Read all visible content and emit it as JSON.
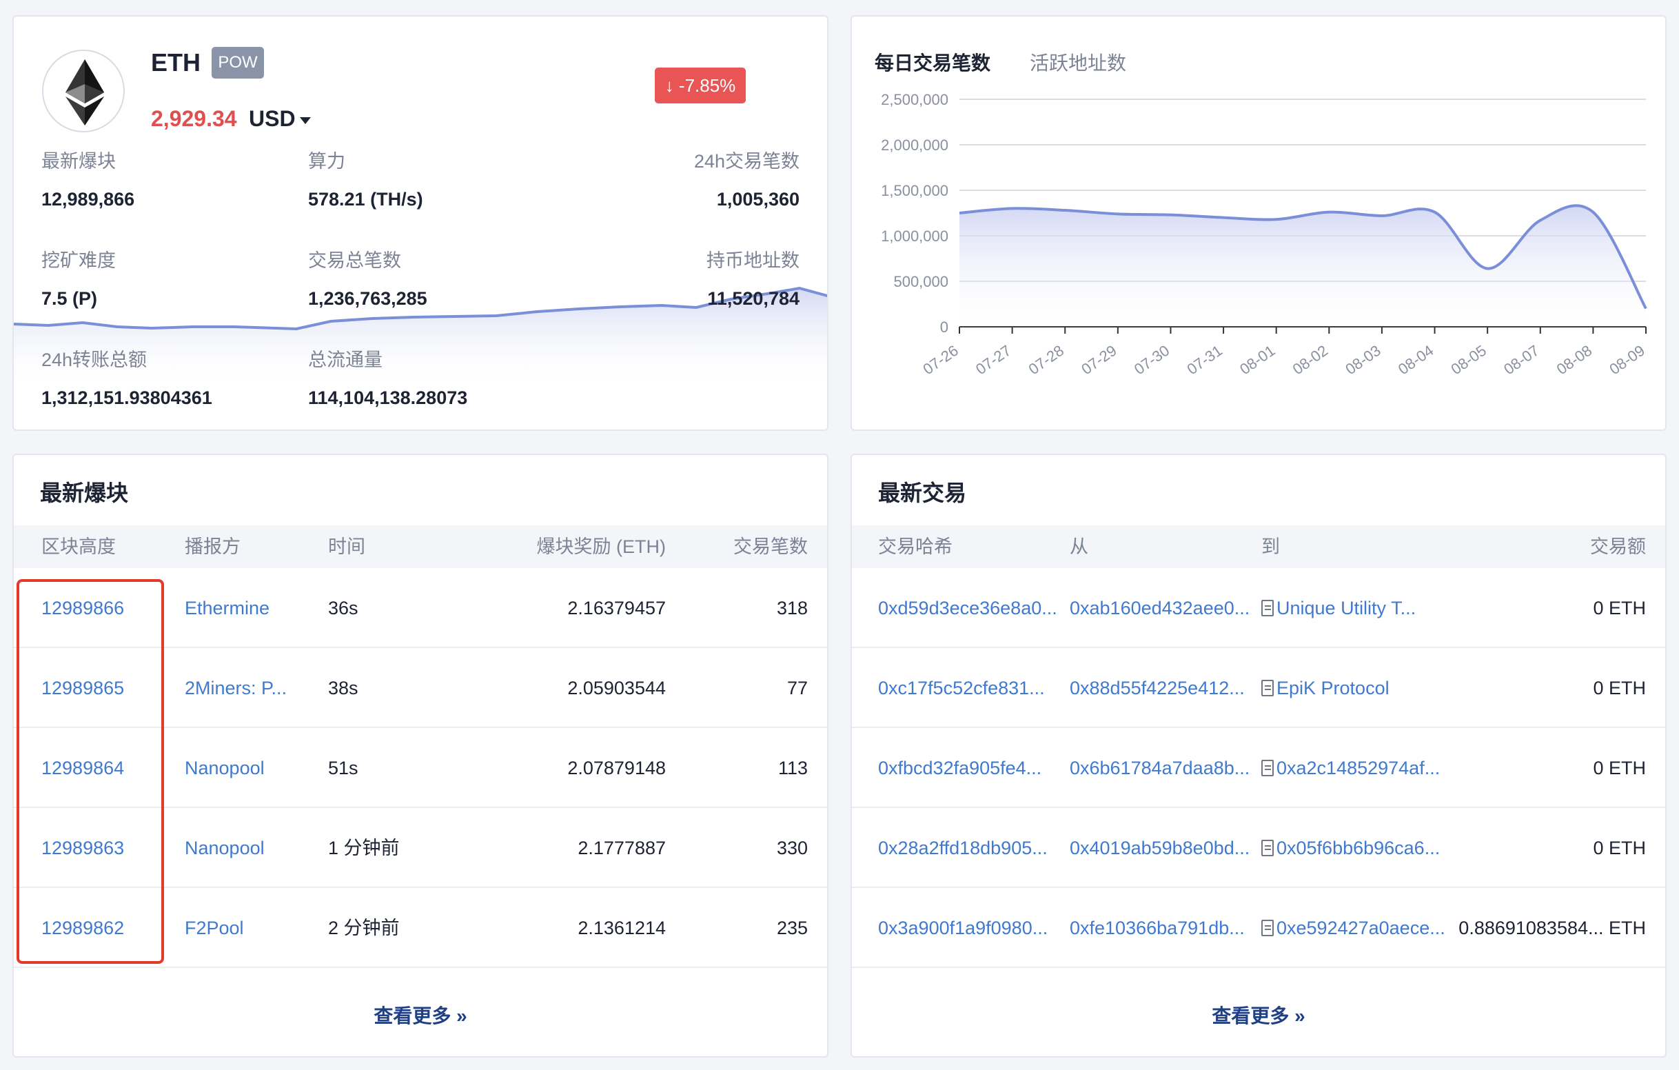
{
  "coin": {
    "name": "ETH",
    "badge": "POW",
    "price": "2,929.34",
    "currency": "USD",
    "change": "-7.85%",
    "change_color": "#e95454",
    "stats": [
      {
        "label": "最新爆块",
        "value": "12,989,866"
      },
      {
        "label": "算力",
        "value": "578.21 (TH/s)"
      },
      {
        "label": "24h交易笔数",
        "value": "1,005,360"
      },
      {
        "label": "挖矿难度",
        "value": "7.5 (P)"
      },
      {
        "label": "交易总笔数",
        "value": "1,236,763,285"
      },
      {
        "label": "持币地址数",
        "value": "11,520,784"
      },
      {
        "label": "24h转账总额",
        "value": "1,312,151.93804361"
      },
      {
        "label": "总流通量",
        "value": "114,104,138.28073"
      }
    ]
  },
  "chart_tabs": {
    "active": "每日交易笔数",
    "inactive": "活跃地址数"
  },
  "chart_data": {
    "type": "area",
    "categories": [
      "07-26",
      "07-27",
      "07-28",
      "07-29",
      "07-30",
      "07-31",
      "08-01",
      "08-02",
      "08-03",
      "08-04",
      "08-05",
      "08-07",
      "08-08",
      "08-09"
    ],
    "values": [
      1250000,
      1300000,
      1280000,
      1240000,
      1230000,
      1200000,
      1180000,
      1260000,
      1220000,
      1260000,
      640000,
      1170000,
      1260000,
      200000
    ],
    "yticks": [
      "0",
      "500,000",
      "1,000,000",
      "1,500,000",
      "2,000,000",
      "2,500,000"
    ],
    "ylim": [
      0,
      2500000
    ],
    "line_color": "#7b8fd8",
    "grid": true
  },
  "blocks": {
    "title": "最新爆块",
    "headers": {
      "height": "区块高度",
      "miner": "播报方",
      "time": "时间",
      "reward": "爆块奖励 (ETH)",
      "txs": "交易笔数"
    },
    "rows": [
      {
        "height": "12989866",
        "miner": "Ethermine",
        "time": "36s",
        "reward": "2.16379457",
        "txs": "318"
      },
      {
        "height": "12989865",
        "miner": "2Miners: P...",
        "time": "38s",
        "reward": "2.05903544",
        "txs": "77"
      },
      {
        "height": "12989864",
        "miner": "Nanopool",
        "time": "51s",
        "reward": "2.07879148",
        "txs": "113"
      },
      {
        "height": "12989863",
        "miner": "Nanopool",
        "time": "1 分钟前",
        "reward": "2.1777887",
        "txs": "330"
      },
      {
        "height": "12989862",
        "miner": "F2Pool",
        "time": "2 分钟前",
        "reward": "2.1361214",
        "txs": "235"
      }
    ],
    "more": "查看更多 »"
  },
  "transactions": {
    "title": "最新交易",
    "headers": {
      "hash": "交易哈希",
      "from": "从",
      "to": "到",
      "amount": "交易额"
    },
    "rows": [
      {
        "hash": "0xd59d3ece36e8a0...",
        "from": "0xab160ed432aee0...",
        "to": "Unique Utility T...",
        "amount": "0 ETH"
      },
      {
        "hash": "0xc17f5c52cfe831...",
        "from": "0x88d55f4225e412...",
        "to": "EpiK Protocol",
        "amount": "0 ETH"
      },
      {
        "hash": "0xfbcd32fa905fe4...",
        "from": "0x6b61784a7daa8b...",
        "to": "0xa2c14852974af...",
        "amount": "0 ETH"
      },
      {
        "hash": "0x28a2ffd18db905...",
        "from": "0x4019ab59b8e0bd...",
        "to": "0x05f6bb6b96ca6...",
        "amount": "0 ETH"
      },
      {
        "hash": "0x3a900f1a9f0980...",
        "from": "0xfe10366ba791db...",
        "to": "0xe592427a0aece...",
        "amount": "0.88691083584... ETH"
      }
    ],
    "more": "查看更多 »"
  }
}
